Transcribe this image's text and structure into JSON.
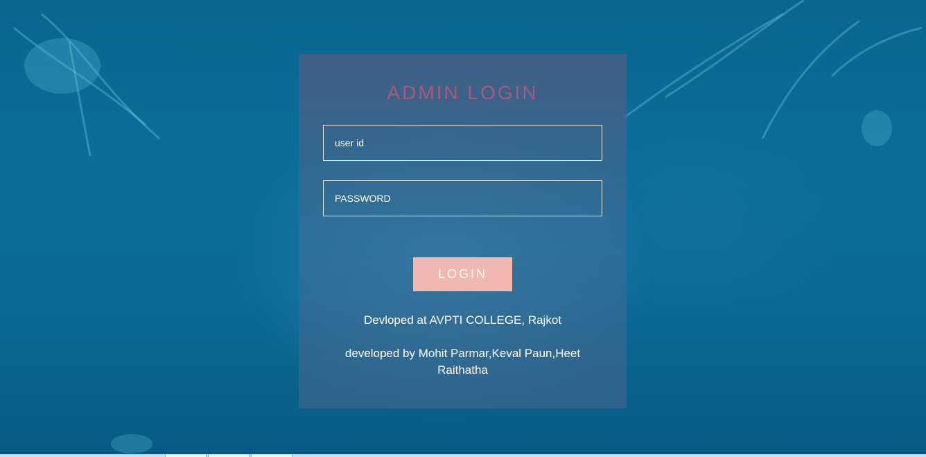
{
  "login": {
    "title": "ADMIN LOGIN",
    "user_placeholder": "user id",
    "password_placeholder": "PASSWORD",
    "button_label": "LOGIN"
  },
  "footer": {
    "college_line": "Devloped at AVPTI COLLEGE, Rajkot",
    "developers_line": "developed by Mohit Parmar,Keval Paun,Heet Raithatha"
  },
  "colors": {
    "title": "#a85a7e",
    "button": "#f0b8b0",
    "background": "#0a6e9a"
  }
}
